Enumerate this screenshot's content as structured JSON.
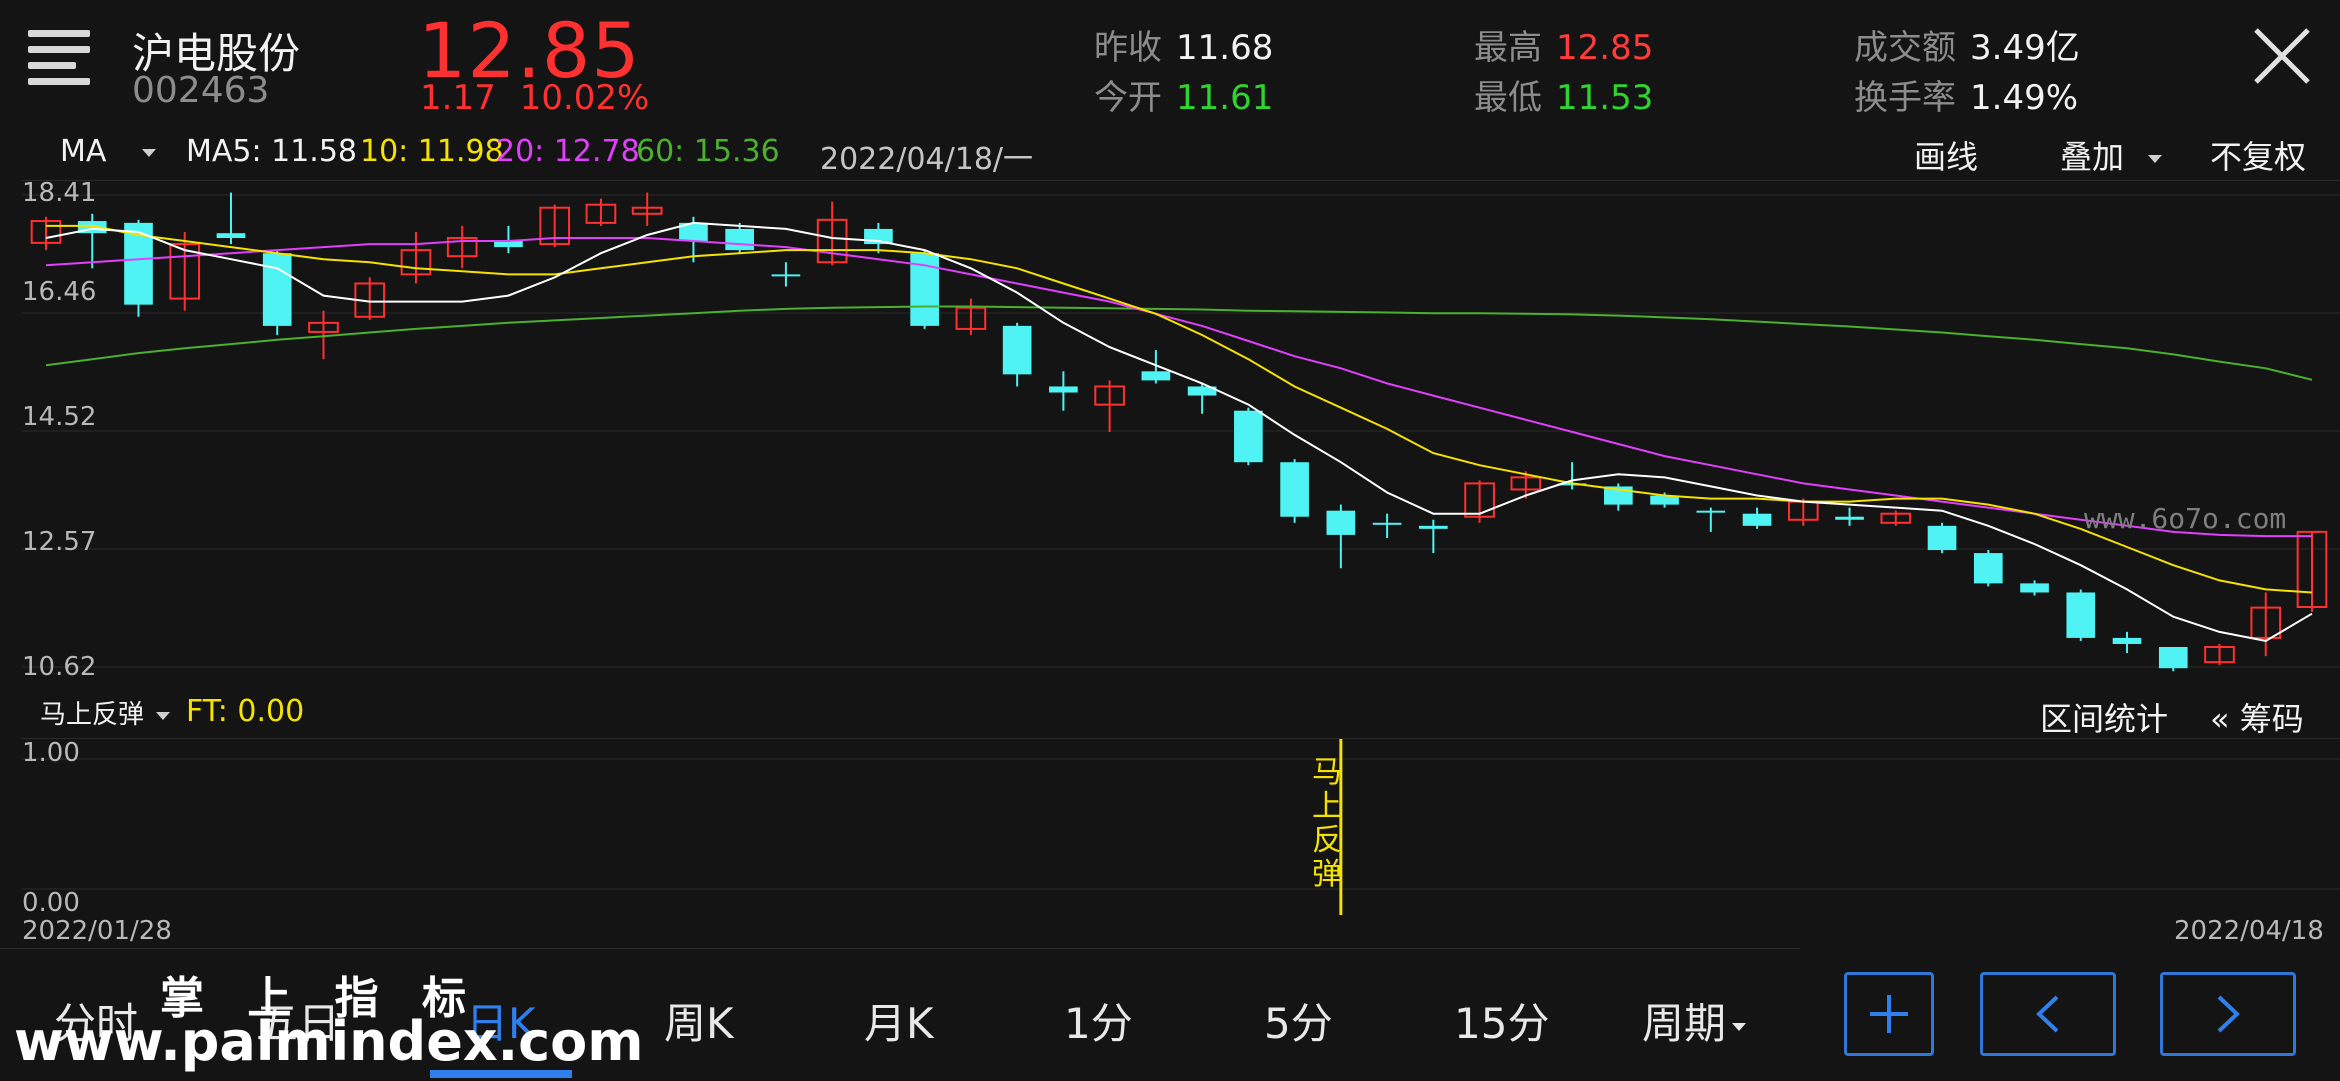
{
  "header": {
    "name": "沪电股份",
    "code": "002463",
    "price": "12.85",
    "change": "1.17",
    "change_pct": "10.02%",
    "stats": {
      "prev_close_label": "昨收",
      "prev_close": "11.68",
      "open_label": "今开",
      "open": "11.61",
      "high_label": "最高",
      "high": "12.85",
      "low_label": "最低",
      "low": "11.53",
      "amount_label": "成交额",
      "amount": "3.49亿",
      "turnover_label": "换手率",
      "turnover": "1.49%"
    }
  },
  "ma_bar": {
    "selector": "MA",
    "ma5": "MA5: 11.58",
    "ma10": "10: 11.98",
    "ma20": "20: 12.78",
    "ma60": "60: 15.36",
    "date": "2022/04/18/一",
    "draw": "画线",
    "overlay": "叠加",
    "adjust": "不复权"
  },
  "price_axis": [
    "18.41",
    "16.46",
    "14.52",
    "12.57",
    "10.62"
  ],
  "sub_indicator": {
    "name": "马上反弹",
    "ft": "FT: 0.00",
    "range_stats": "区间统计",
    "chips": "« 筹码",
    "axis_top": "1.00",
    "axis_bottom": "0.00",
    "signal_text": "马上反弹"
  },
  "dates": {
    "start": "2022/01/28",
    "end": "2022/04/18"
  },
  "tabs": [
    "分时",
    "五日",
    "日K",
    "周K",
    "月K",
    "1分",
    "5分",
    "15分",
    "周期"
  ],
  "active_tab": "日K",
  "watermarks": {
    "site1": "www.6o7o.com",
    "site2": "www.palmindex.com",
    "brand": "掌 上 指 标"
  },
  "colors": {
    "up": "#ff3030",
    "down": "#4ff3f3",
    "ma5": "#ffffff",
    "ma10": "#f5e200",
    "ma20": "#e040fb",
    "ma60": "#4caf2f",
    "accent": "#2f80ed"
  },
  "chart_data": {
    "type": "candlestick",
    "ylim": [
      10.62,
      18.41
    ],
    "candles": [
      {
        "o": 17.62,
        "c": 17.98,
        "h": 18.05,
        "l": 17.5
      },
      {
        "o": 17.98,
        "c": 17.78,
        "h": 18.1,
        "l": 17.2
      },
      {
        "o": 17.95,
        "c": 16.6,
        "h": 18.0,
        "l": 16.4
      },
      {
        "o": 16.7,
        "c": 17.6,
        "h": 17.8,
        "l": 16.5
      },
      {
        "o": 17.78,
        "c": 17.7,
        "h": 18.45,
        "l": 17.6
      },
      {
        "o": 17.45,
        "c": 16.25,
        "h": 17.5,
        "l": 16.1
      },
      {
        "o": 16.15,
        "c": 16.3,
        "h": 16.5,
        "l": 15.7
      },
      {
        "o": 16.4,
        "c": 16.95,
        "h": 17.05,
        "l": 16.35
      },
      {
        "o": 17.1,
        "c": 17.5,
        "h": 17.8,
        "l": 16.95
      },
      {
        "o": 17.4,
        "c": 17.7,
        "h": 17.9,
        "l": 17.2
      },
      {
        "o": 17.65,
        "c": 17.55,
        "h": 17.9,
        "l": 17.45
      },
      {
        "o": 17.6,
        "c": 18.2,
        "h": 18.25,
        "l": 17.55
      },
      {
        "o": 17.95,
        "c": 18.25,
        "h": 18.35,
        "l": 17.9
      },
      {
        "o": 18.1,
        "c": 18.2,
        "h": 18.45,
        "l": 17.9
      },
      {
        "o": 17.95,
        "c": 17.65,
        "h": 18.05,
        "l": 17.3
      },
      {
        "o": 17.85,
        "c": 17.5,
        "h": 17.95,
        "l": 17.45
      },
      {
        "o": 17.1,
        "c": 17.1,
        "h": 17.3,
        "l": 16.9
      },
      {
        "o": 17.3,
        "c": 18.0,
        "h": 18.3,
        "l": 17.25
      },
      {
        "o": 17.85,
        "c": 17.6,
        "h": 17.95,
        "l": 17.45
      },
      {
        "o": 17.45,
        "c": 16.25,
        "h": 17.5,
        "l": 16.2
      },
      {
        "o": 16.2,
        "c": 16.55,
        "h": 16.7,
        "l": 16.1
      },
      {
        "o": 16.25,
        "c": 15.45,
        "h": 16.3,
        "l": 15.25
      },
      {
        "o": 15.25,
        "c": 15.15,
        "h": 15.5,
        "l": 14.85
      },
      {
        "o": 14.95,
        "c": 15.25,
        "h": 15.35,
        "l": 14.5
      },
      {
        "o": 15.5,
        "c": 15.35,
        "h": 15.85,
        "l": 15.3
      },
      {
        "o": 15.25,
        "c": 15.1,
        "h": 15.3,
        "l": 14.8
      },
      {
        "o": 14.85,
        "c": 14.0,
        "h": 14.9,
        "l": 13.95
      },
      {
        "o": 14.0,
        "c": 13.1,
        "h": 14.05,
        "l": 13.0
      },
      {
        "o": 13.2,
        "c": 12.8,
        "h": 13.3,
        "l": 12.25
      },
      {
        "o": 13.0,
        "c": 13.0,
        "h": 13.15,
        "l": 12.75
      },
      {
        "o": 12.95,
        "c": 12.9,
        "h": 13.05,
        "l": 12.5
      },
      {
        "o": 13.1,
        "c": 13.65,
        "h": 13.7,
        "l": 13.0
      },
      {
        "o": 13.55,
        "c": 13.75,
        "h": 13.85,
        "l": 13.4
      },
      {
        "o": 13.65,
        "c": 13.65,
        "h": 14.0,
        "l": 13.55
      },
      {
        "o": 13.6,
        "c": 13.3,
        "h": 13.65,
        "l": 13.2
      },
      {
        "o": 13.45,
        "c": 13.3,
        "h": 13.5,
        "l": 13.25
      },
      {
        "o": 13.2,
        "c": 13.2,
        "h": 13.25,
        "l": 12.85
      },
      {
        "o": 13.15,
        "c": 12.95,
        "h": 13.25,
        "l": 12.9
      },
      {
        "o": 13.05,
        "c": 13.35,
        "h": 13.4,
        "l": 12.95
      },
      {
        "o": 13.1,
        "c": 13.05,
        "h": 13.25,
        "l": 12.95
      },
      {
        "o": 13.0,
        "c": 13.15,
        "h": 13.2,
        "l": 12.95
      },
      {
        "o": 12.95,
        "c": 12.55,
        "h": 13.0,
        "l": 12.5
      },
      {
        "o": 12.5,
        "c": 12.0,
        "h": 12.55,
        "l": 11.95
      },
      {
        "o": 12.0,
        "c": 11.85,
        "h": 12.05,
        "l": 11.8
      },
      {
        "o": 11.85,
        "c": 11.1,
        "h": 11.9,
        "l": 11.05
      },
      {
        "o": 11.1,
        "c": 11.0,
        "h": 11.2,
        "l": 10.85
      },
      {
        "o": 10.95,
        "c": 10.6,
        "h": 10.95,
        "l": 10.55
      },
      {
        "o": 10.7,
        "c": 10.95,
        "h": 11.0,
        "l": 10.65
      },
      {
        "o": 11.1,
        "c": 11.6,
        "h": 11.85,
        "l": 10.8
      },
      {
        "o": 11.61,
        "c": 12.85,
        "h": 12.85,
        "l": 11.53
      }
    ],
    "ma5": [
      17.7,
      17.85,
      17.8,
      17.5,
      17.35,
      17.2,
      16.75,
      16.65,
      16.65,
      16.65,
      16.75,
      17.05,
      17.45,
      17.75,
      17.95,
      17.9,
      17.85,
      17.7,
      17.65,
      17.5,
      17.2,
      16.8,
      16.3,
      15.9,
      15.6,
      15.3,
      14.95,
      14.45,
      14.0,
      13.5,
      13.15,
      13.15,
      13.45,
      13.7,
      13.8,
      13.75,
      13.6,
      13.45,
      13.35,
      13.3,
      13.25,
      13.2,
      12.95,
      12.65,
      12.3,
      11.9,
      11.45,
      11.2,
      11.05,
      11.5
    ],
    "ma10": [
      17.9,
      17.9,
      17.75,
      17.65,
      17.55,
      17.45,
      17.35,
      17.3,
      17.2,
      17.15,
      17.1,
      17.1,
      17.2,
      17.3,
      17.4,
      17.45,
      17.5,
      17.5,
      17.5,
      17.45,
      17.35,
      17.2,
      16.95,
      16.7,
      16.45,
      16.1,
      15.7,
      15.25,
      14.9,
      14.55,
      14.15,
      13.95,
      13.8,
      13.65,
      13.55,
      13.45,
      13.4,
      13.4,
      13.35,
      13.35,
      13.4,
      13.4,
      13.3,
      13.15,
      12.9,
      12.6,
      12.3,
      12.05,
      11.9,
      11.85
    ],
    "ma20": [
      17.25,
      17.3,
      17.35,
      17.4,
      17.45,
      17.5,
      17.55,
      17.6,
      17.6,
      17.65,
      17.65,
      17.7,
      17.7,
      17.7,
      17.65,
      17.6,
      17.55,
      17.45,
      17.35,
      17.25,
      17.1,
      16.95,
      16.8,
      16.65,
      16.45,
      16.25,
      16.0,
      15.75,
      15.55,
      15.3,
      15.1,
      14.9,
      14.7,
      14.5,
      14.3,
      14.1,
      13.95,
      13.8,
      13.65,
      13.55,
      13.45,
      13.35,
      13.25,
      13.15,
      13.05,
      12.95,
      12.85,
      12.8,
      12.78,
      12.78
    ],
    "ma60": [
      15.6,
      15.7,
      15.8,
      15.88,
      15.95,
      16.02,
      16.08,
      16.14,
      16.2,
      16.25,
      16.3,
      16.34,
      16.38,
      16.42,
      16.46,
      16.5,
      16.53,
      16.55,
      16.56,
      16.57,
      16.57,
      16.56,
      16.55,
      16.54,
      16.53,
      16.52,
      16.5,
      16.49,
      16.48,
      16.47,
      16.46,
      16.46,
      16.45,
      16.44,
      16.42,
      16.39,
      16.36,
      16.32,
      16.28,
      16.24,
      16.19,
      16.14,
      16.08,
      16.02,
      15.95,
      15.88,
      15.78,
      15.66,
      15.55,
      15.36
    ],
    "signal_index": 28,
    "signal_value": 1.0,
    "sub_ylim": [
      0,
      1
    ]
  }
}
